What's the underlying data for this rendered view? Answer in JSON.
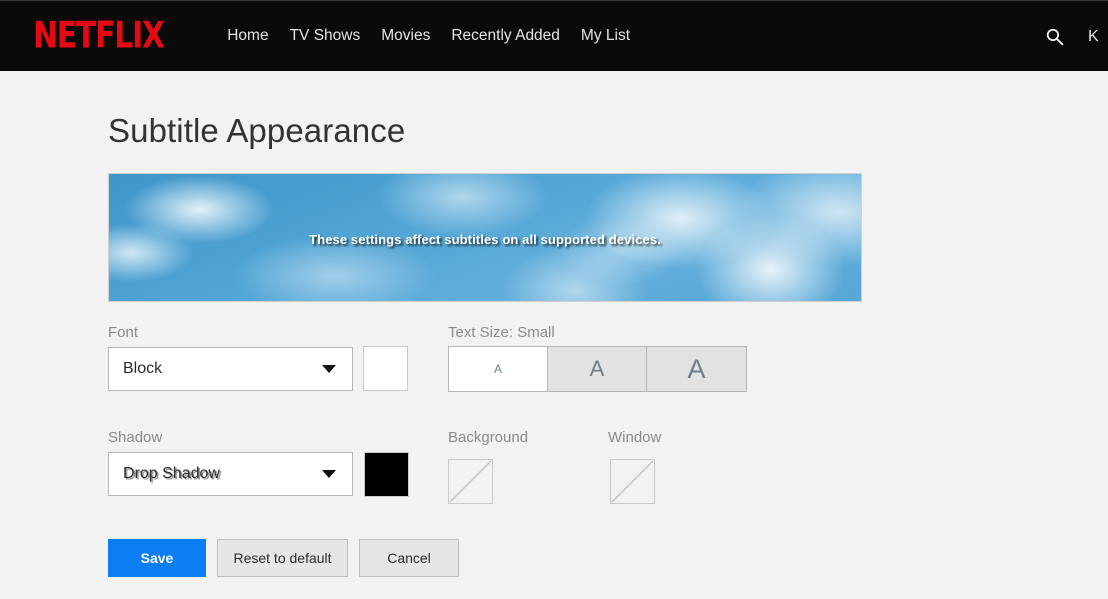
{
  "navbar": {
    "logo": "NETFLIX",
    "links": [
      {
        "label": "Home"
      },
      {
        "label": "TV Shows"
      },
      {
        "label": "Movies"
      },
      {
        "label": "Recently Added"
      },
      {
        "label": "My List"
      }
    ],
    "search_icon": "search-icon",
    "profile_initial": "K",
    "background_color": "#0a0a0a",
    "logo_color": "#e50914",
    "link_color": "#e5e5e5"
  },
  "page": {
    "title": "Subtitle Appearance",
    "background_color": "#f2f2f2"
  },
  "preview": {
    "text": "These settings affect subtitles on all supported devices."
  },
  "font_field": {
    "label": "Font",
    "value": "Block",
    "swatch_color": "#ffffff",
    "caret_icon": "chevron-down-icon"
  },
  "text_size_field": {
    "label": "Text Size: Small",
    "selected": "Small",
    "options": [
      {
        "label": "A",
        "size": "Small",
        "selected": true
      },
      {
        "label": "A",
        "size": "Medium",
        "selected": false
      },
      {
        "label": "A",
        "size": "Large",
        "selected": false
      }
    ]
  },
  "shadow_field": {
    "label": "Shadow",
    "value": "Drop Shadow",
    "swatch_color": "#000000",
    "caret_icon": "chevron-down-icon"
  },
  "background_field": {
    "label": "Background",
    "swatch_color": "transparent"
  },
  "window_field": {
    "label": "Window",
    "swatch_color": "transparent"
  },
  "actions": {
    "save_label": "Save",
    "reset_label": "Reset to default",
    "cancel_label": "Cancel",
    "primary_color": "#0b7ef4"
  }
}
